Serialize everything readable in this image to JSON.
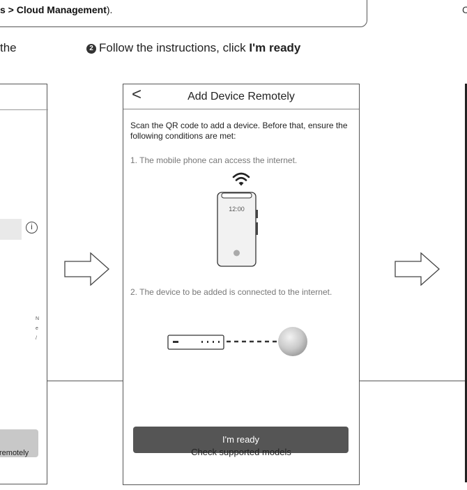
{
  "note": {
    "prefix": "s > ",
    "emph": "Cloud Management",
    "suffix": ")."
  },
  "stray_char": "C",
  "step_left_text": "the",
  "step2": {
    "number": "2",
    "text": "Follow the instructions, click ",
    "emph": "I'm ready"
  },
  "left_phone": {
    "info_icon_glyph": "i",
    "tiny_lines": [
      "N",
      "e",
      "/"
    ],
    "remotely_text": "remotely"
  },
  "phone": {
    "back_glyph": "<",
    "title": "Add Device Remotely",
    "intro": "Scan the QR code to add a device. Before that, ensure the following conditions are met:",
    "condition1": "1. The mobile phone can access the internet.",
    "phone_time": "12:00",
    "condition2": "2. The device to be added is connected to the internet.",
    "ready_button": "I'm ready",
    "check_link": "Check supported models"
  },
  "icons": [
    "back-chevron-icon",
    "wifi-icon",
    "smartphone-icon",
    "switch-device-icon",
    "globe-icon",
    "info-icon",
    "right-arrow-icon"
  ],
  "colors": {
    "button": "#555555",
    "border": "#555555",
    "muted_text": "#777777"
  }
}
